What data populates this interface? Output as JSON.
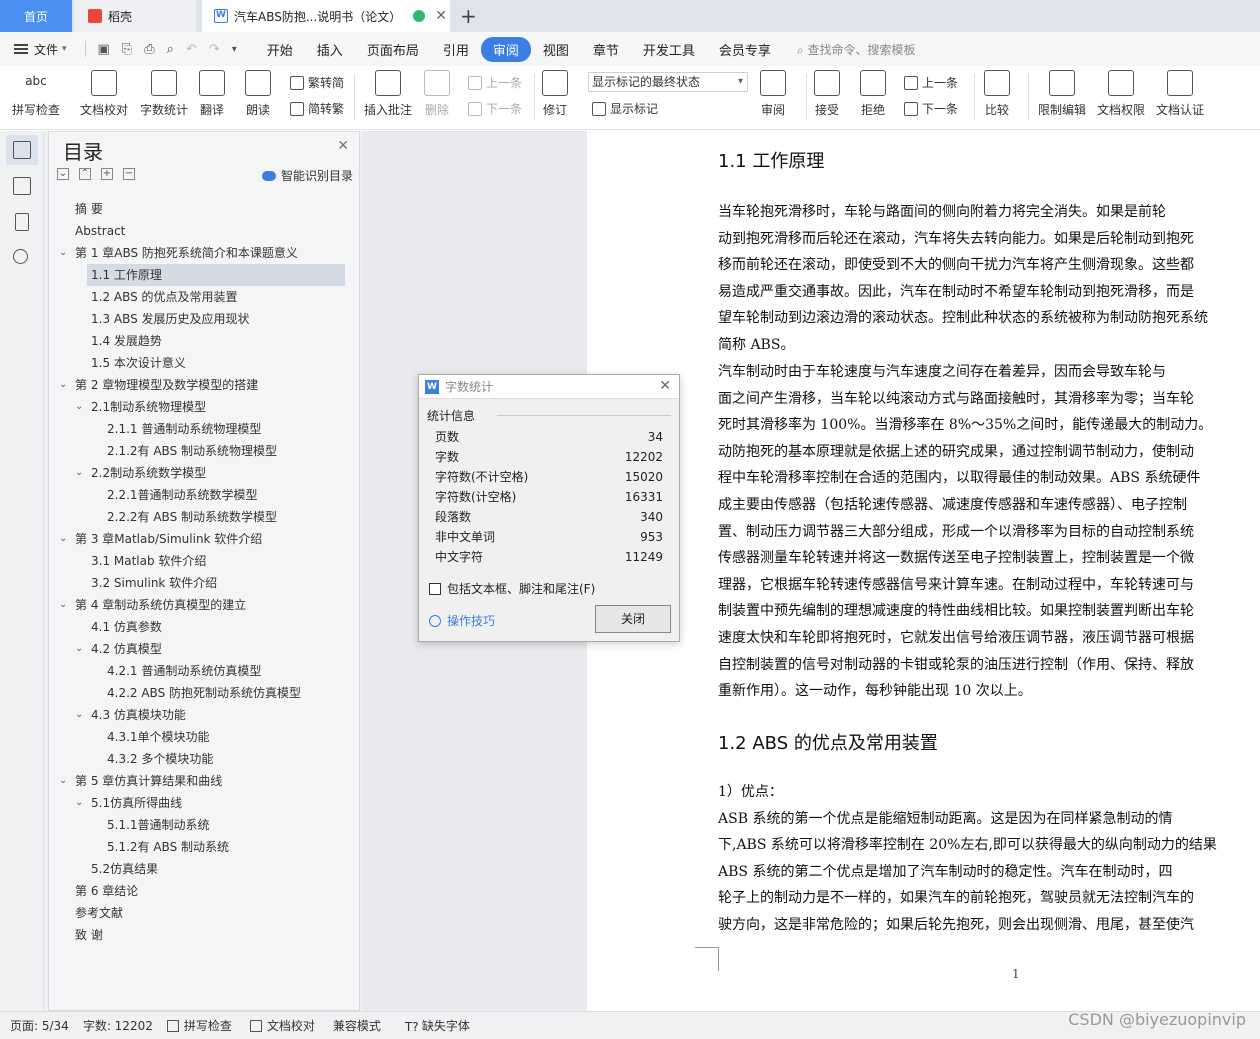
{
  "tabs": {
    "home": "首页",
    "daoke": "稻壳",
    "doc": "汽车ABS防抱...说明书（论文）"
  },
  "menubar": {
    "file": "文件",
    "menus": [
      "开始",
      "插入",
      "页面布局",
      "引用",
      "审阅",
      "视图",
      "章节",
      "开发工具",
      "会员专享"
    ],
    "active_menu": "审阅",
    "search": "查找命令、搜索模板"
  },
  "ribbon": {
    "spell": "拼写检查",
    "doc_check": "文档校对",
    "word_count": "字数统计",
    "translate": "翻译",
    "read": "朗读",
    "trad": "繁转简",
    "simp": "简转繁",
    "insert_comment": "插入批注",
    "delete": "删除",
    "prev_comment": "上一条",
    "next_comment": "下一条",
    "revise": "修订",
    "markup_combo": "显示标记的最终状态",
    "show_markup": "显示标记",
    "review": "审阅",
    "accept": "接受",
    "reject": "拒绝",
    "prev": "上一条",
    "next": "下一条",
    "compare": "比较",
    "restrict": "限制编辑",
    "permission": "文档权限",
    "certify": "文档认证"
  },
  "toc": {
    "title": "目录",
    "smart": "智能识别目录",
    "items": [
      {
        "label": "摘  要",
        "level": 0,
        "arrow": false
      },
      {
        "label": "Abstract",
        "level": 0,
        "arrow": false
      },
      {
        "label": "第 1 章ABS 防抱死系统简介和本课题意义",
        "level": 0,
        "arrow": true
      },
      {
        "label": "1.1  工作原理",
        "level": 1,
        "arrow": false,
        "selected": true
      },
      {
        "label": "1.2  ABS 的优点及常用装置",
        "level": 1,
        "arrow": false
      },
      {
        "label": "1.3  ABS 发展历史及应用现状",
        "level": 1,
        "arrow": false
      },
      {
        "label": "1.4  发展趋势",
        "level": 1,
        "arrow": false
      },
      {
        "label": "1.5  本次设计意义",
        "level": 1,
        "arrow": false
      },
      {
        "label": "第 2 章物理模型及数学模型的搭建",
        "level": 0,
        "arrow": true
      },
      {
        "label": "2.1制动系统物理模型",
        "level": 1,
        "arrow": true
      },
      {
        "label": "2.1.1  普通制动系统物理模型",
        "level": 2,
        "arrow": false
      },
      {
        "label": "2.1.2有 ABS 制动系统物理模型",
        "level": 2,
        "arrow": false
      },
      {
        "label": "2.2制动系统数学模型",
        "level": 1,
        "arrow": true
      },
      {
        "label": "2.2.1普通制动系统数学模型",
        "level": 2,
        "arrow": false
      },
      {
        "label": "2.2.2有 ABS 制动系统数学模型",
        "level": 2,
        "arrow": false
      },
      {
        "label": "第 3 章Matlab/Simulink 软件介绍",
        "level": 0,
        "arrow": true
      },
      {
        "label": "3.1  Matlab 软件介绍",
        "level": 1,
        "arrow": false
      },
      {
        "label": "3.2  Simulink 软件介绍",
        "level": 1,
        "arrow": false
      },
      {
        "label": "第 4 章制动系统仿真模型的建立",
        "level": 0,
        "arrow": true
      },
      {
        "label": "4.1  仿真参数",
        "level": 1,
        "arrow": false
      },
      {
        "label": "4.2  仿真模型",
        "level": 1,
        "arrow": true
      },
      {
        "label": "4.2.1  普通制动系统仿真模型",
        "level": 2,
        "arrow": false
      },
      {
        "label": "4.2.2  ABS 防抱死制动系统仿真模型",
        "level": 2,
        "arrow": false
      },
      {
        "label": "4.3  仿真模块功能",
        "level": 1,
        "arrow": true
      },
      {
        "label": "4.3.1单个模块功能",
        "level": 2,
        "arrow": false
      },
      {
        "label": "4.3.2  多个模块功能",
        "level": 2,
        "arrow": false
      },
      {
        "label": "第 5 章仿真计算结果和曲线",
        "level": 0,
        "arrow": true
      },
      {
        "label": "5.1仿真所得曲线",
        "level": 1,
        "arrow": true
      },
      {
        "label": "5.1.1普通制动系统",
        "level": 2,
        "arrow": false
      },
      {
        "label": "5.1.2有 ABS 制动系统",
        "level": 2,
        "arrow": false
      },
      {
        "label": "5.2仿真结果",
        "level": 1,
        "arrow": false
      },
      {
        "label": "第 6 章结论",
        "level": 0,
        "arrow": false
      },
      {
        "label": "参考文献",
        "level": 0,
        "arrow": false
      },
      {
        "label": "致  谢",
        "level": 0,
        "arrow": false
      }
    ]
  },
  "document": {
    "heading1": "1.1   工作原理",
    "para1": [
      "    当车轮抱死滑移时，车轮与路面间的侧向附着力将完全消失。如果是前轮",
      "动到抱死滑移而后轮还在滚动，汽车将失去转向能力。如果是后轮制动到抱死",
      "移而前轮还在滚动，即使受到不大的侧向干扰力汽车将产生侧滑现象。这些都",
      "易造成严重交通事故。因此，汽车在制动时不希望车轮制动到抱死滑移，而是",
      "望车轮制动到边滚边滑的滚动状态。控制此种状态的系统被称为制动防抱死系统",
      "简称 ABS。"
    ],
    "para2": [
      "    汽车制动时由于车轮速度与汽车速度之间存在着差异，因而会导致车轮与",
      "面之间产生滑移，当车轮以纯滚动方式与路面接触时，其滑移率为零；当车轮",
      "死时其滑移率为 100%。当滑移率在 8%～35%之间时，能传递最大的制动力。",
      "动防抱死的基本原理就是依据上述的研究成果，通过控制调节制动力，使制动",
      "程中车轮滑移率控制在合适的范围内，以取得最佳的制动效果。ABS 系统硬件",
      "成主要由传感器（包括轮速传感器、减速度传感器和车速传感器）、电子控制",
      "置、制动压力调节器三大部分组成，形成一个以滑移率为目标的自动控制系统",
      "传感器测量车轮转速并将这一数据传送至电子控制装置上，控制装置是一个微",
      "理器，它根据车轮转速传感器信号来计算车速。在制动过程中，车轮转速可与",
      "制装置中预先编制的理想减速度的特性曲线相比较。如果控制装置判断出车轮",
      "速度太快和车轮即将抱死时，它就发出信号给液压调节器，液压调节器可根据",
      "自控制装置的信号对制动器的卡钳或轮泵的油压进行控制（作用、保持、释放",
      "重新作用）。这一动作，每秒钟能出现 10 次以上。"
    ],
    "heading2": "1.2   ABS 的优点及常用装置",
    "para3": [
      "    1）优点：",
      "    ASB 系统的第一个优点是能缩短制动距离。这是因为在同样紧急制动的情",
      "下,ABS 系统可以将滑移率控制在 20%左右,即可以获得最大的纵向制动力的结果",
      "    ABS 系统的第二个优点是增加了汽车制动时的稳定性。汽车在制动时，四",
      "轮子上的制动力是不一样的，如果汽车的前轮抱死，驾驶员就无法控制汽车的",
      "驶方向，这是非常危险的；如果后轮先抱死，则会出现侧滑、甩尾，甚至使汽"
    ],
    "page_number": "1"
  },
  "dialog": {
    "title": "字数统计",
    "group": "统计信息",
    "stats": [
      {
        "label": "页数",
        "value": "34"
      },
      {
        "label": "字数",
        "value": "12202"
      },
      {
        "label": "字符数(不计空格)",
        "value": "15020"
      },
      {
        "label": "字符数(计空格)",
        "value": "16331"
      },
      {
        "label": "段落数",
        "value": "340"
      },
      {
        "label": "非中文单词",
        "value": "953"
      },
      {
        "label": "中文字符",
        "value": "11249"
      }
    ],
    "include": "包括文本框、脚注和尾注(F)",
    "tips": "操作技巧",
    "close": "关闭"
  },
  "statusbar": {
    "page": "页面: 5/34",
    "words": "字数: 12202",
    "spell": "拼写检查",
    "doc_check": "文档校对",
    "compat": "兼容模式",
    "missing_font": "缺失字体"
  },
  "watermark": "CSDN @biyezuopinvip"
}
